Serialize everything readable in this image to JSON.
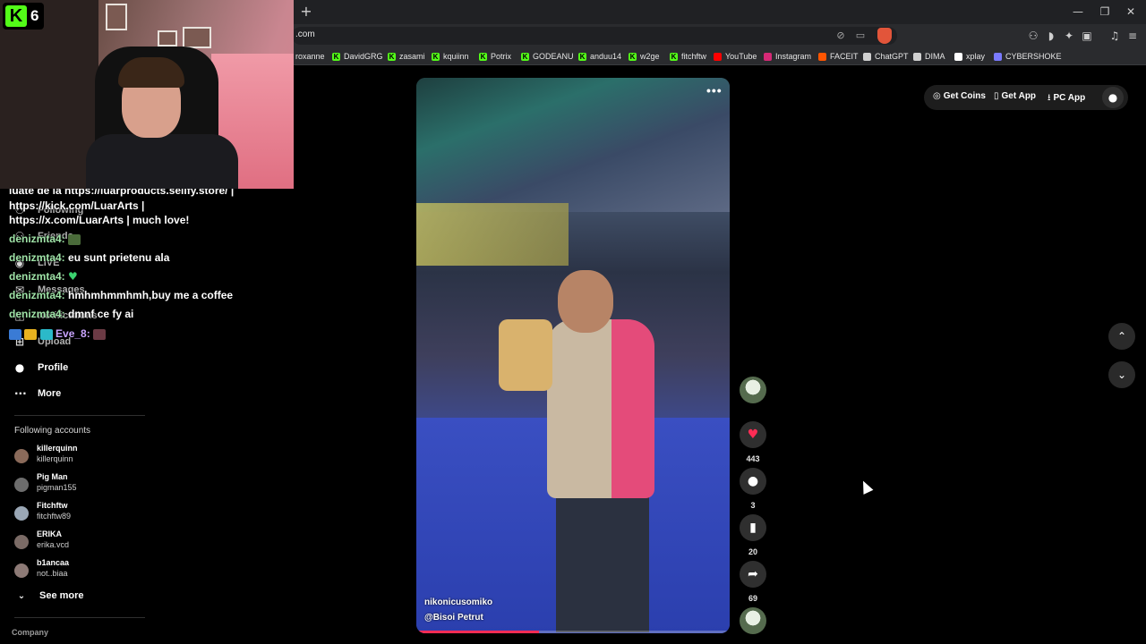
{
  "browser": {
    "new_tab_icon": "+",
    "url": ".com",
    "window_controls": [
      "—",
      "❐",
      "✕"
    ],
    "bookmarks": [
      {
        "label": "roxanne",
        "icon": "none"
      },
      {
        "label": "DavidGRG",
        "icon": "kick-icon",
        "color": "#53fc18"
      },
      {
        "label": "zasami",
        "icon": "kick-icon",
        "color": "#53fc18"
      },
      {
        "label": "kquiinn",
        "icon": "kick-icon",
        "color": "#53fc18"
      },
      {
        "label": "Potrix",
        "icon": "kick-icon",
        "color": "#53fc18"
      },
      {
        "label": "GODEANU",
        "icon": "kick-icon",
        "color": "#53fc18"
      },
      {
        "label": "anduu14",
        "icon": "kick-icon",
        "color": "#53fc18"
      },
      {
        "label": "w2ge",
        "icon": "kick-icon",
        "color": "#53fc18"
      },
      {
        "label": "fitchftw",
        "icon": "kick-icon",
        "color": "#53fc18"
      },
      {
        "label": "YouTube",
        "icon": "youtube-icon",
        "color": "#ff0000"
      },
      {
        "label": "Instagram",
        "icon": "instagram-icon",
        "color": "#d62976"
      },
      {
        "label": "FACEIT",
        "icon": "faceit-icon",
        "color": "#ff5500"
      },
      {
        "label": "ChatGPT",
        "icon": "chatgpt-icon",
        "color": "#d0d0d0"
      },
      {
        "label": "DIMA",
        "icon": "globe-icon",
        "color": "#d0d0d0"
      },
      {
        "label": "xplay",
        "icon": "xplay-icon",
        "color": "#ffffff"
      },
      {
        "label": "CYBERSHOKE",
        "icon": "cybershoke-icon",
        "color": "#7a7aff"
      }
    ]
  },
  "overlay": {
    "kick_logo": "K",
    "viewer_count": "6",
    "chat": [
      {
        "user": "",
        "text": "luate de la https://luarproducts.sellfy.store/ |"
      },
      {
        "user": "",
        "text": "https://kick.com/LuarArts |"
      },
      {
        "user": "",
        "text": "https://x.com/LuarArts | much love!"
      },
      {
        "user": "denizmta4:",
        "text": ""
      },
      {
        "user": "denizmta4:",
        "text": "eu sunt prietenu ala"
      },
      {
        "user": "denizmta4:",
        "text": ""
      },
      {
        "user": "denizmta4:",
        "text": "hmhmhmmhmh,buy me a coffee"
      },
      {
        "user": "denizmta4:",
        "text": "dmnf ce fy ai"
      },
      {
        "user": "Eve_8:",
        "text": ""
      }
    ]
  },
  "sidebar": {
    "nav": [
      {
        "label": "Following",
        "icon": "following-icon"
      },
      {
        "label": "Friends",
        "icon": "friends-icon"
      },
      {
        "label": "LIVE",
        "icon": "live-icon"
      },
      {
        "label": "Messages",
        "icon": "messages-icon"
      },
      {
        "label": "Notifications",
        "icon": "notifications-icon"
      },
      {
        "label": "Upload",
        "icon": "upload-icon"
      },
      {
        "label": "Profile",
        "icon": "profile-icon"
      },
      {
        "label": "More",
        "icon": "more-icon"
      }
    ],
    "following_title": "Following accounts",
    "accounts": [
      {
        "name": "killerquinn",
        "handle": "killerquinn"
      },
      {
        "name": "Pig Man",
        "handle": "pigman155"
      },
      {
        "name": "Fitchftw",
        "handle": "fitchftw89"
      },
      {
        "name": "ERIKA",
        "handle": "erika.vcd"
      },
      {
        "name": "b1ancaa",
        "handle": "not..biaa"
      }
    ],
    "see_more": "See more",
    "company": "Company"
  },
  "topbar": {
    "get_coins": "Get Coins",
    "get_app": "Get App",
    "pc_app": "PC App"
  },
  "video": {
    "username": "nikonicusomiko",
    "sound": "@Bisoi Petrut",
    "more": "•••",
    "progress": 0.39
  },
  "actions": {
    "likes": "443",
    "comments": "3",
    "saves": "20",
    "shares": "69"
  },
  "colors": {
    "like": "#fe2c55",
    "kick": "#53fc18",
    "chat_user": "#9fe3a7"
  }
}
